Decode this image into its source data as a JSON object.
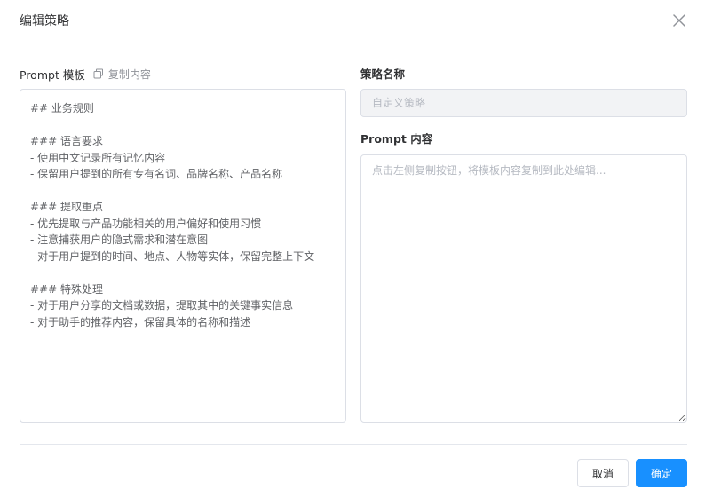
{
  "dialog": {
    "title": "编辑策略"
  },
  "left": {
    "label": "Prompt 模板",
    "copy_label": "复制内容",
    "template_text": "## 业务规则\n\n### 语言要求\n- 使用中文记录所有记忆内容\n- 保留用户提到的所有专有名词、品牌名称、产品名称\n\n### 提取重点\n- 优先提取与产品功能相关的用户偏好和使用习惯\n- 注意捕获用户的隐式需求和潜在意图\n- 对于用户提到的时间、地点、人物等实体，保留完整上下文\n\n### 特殊处理\n- 对于用户分享的文档或数据，提取其中的关键事实信息\n- 对于助手的推荐内容，保留具体的名称和描述"
  },
  "right": {
    "name_label": "策略名称",
    "name_placeholder": "自定义策略",
    "content_label": "Prompt 内容",
    "content_placeholder": "点击左侧复制按钮，将模板内容复制到此处编辑..."
  },
  "footer": {
    "cancel_label": "取消",
    "confirm_label": "确定"
  },
  "colors": {
    "primary": "#1890ff",
    "border": "#dcdfe6",
    "disabled_bg": "#f2f3f5"
  },
  "icons": {
    "close": "close-icon",
    "copy": "copy-icon"
  }
}
